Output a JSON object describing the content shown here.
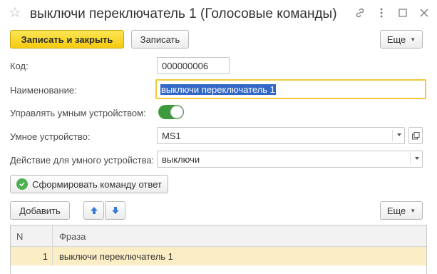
{
  "window": {
    "title": "выключи переключатель 1 (Голосовые команды)"
  },
  "toolbar": {
    "save_close_label": "Записать и закрыть",
    "save_label": "Записать",
    "more_label": "Еще"
  },
  "form": {
    "code_label": "Код:",
    "code_value": "000000006",
    "name_label": "Наименование:",
    "name_value": "выключи переключатель 1",
    "manage_label": "Управлять умным устройством:",
    "manage_enabled": true,
    "device_label": "Умное устройство:",
    "device_value": "MS1",
    "action_label": "Действие для умного устройства:",
    "action_value": "выключи",
    "generate_label": "Сформировать команду ответ"
  },
  "table_toolbar": {
    "add_label": "Добавить",
    "more_label": "Еще"
  },
  "table": {
    "columns": [
      "N",
      "Фраза"
    ],
    "rows": [
      {
        "n": "1",
        "phrase": "выключи переключатель 1"
      }
    ]
  },
  "colors": {
    "primary_button": "#f5ca0e",
    "toggle_on": "#3f9a3e",
    "focus_border": "#f3c93a",
    "selected_row": "#fbeec4",
    "arrow_blue": "#3a7bd5"
  }
}
